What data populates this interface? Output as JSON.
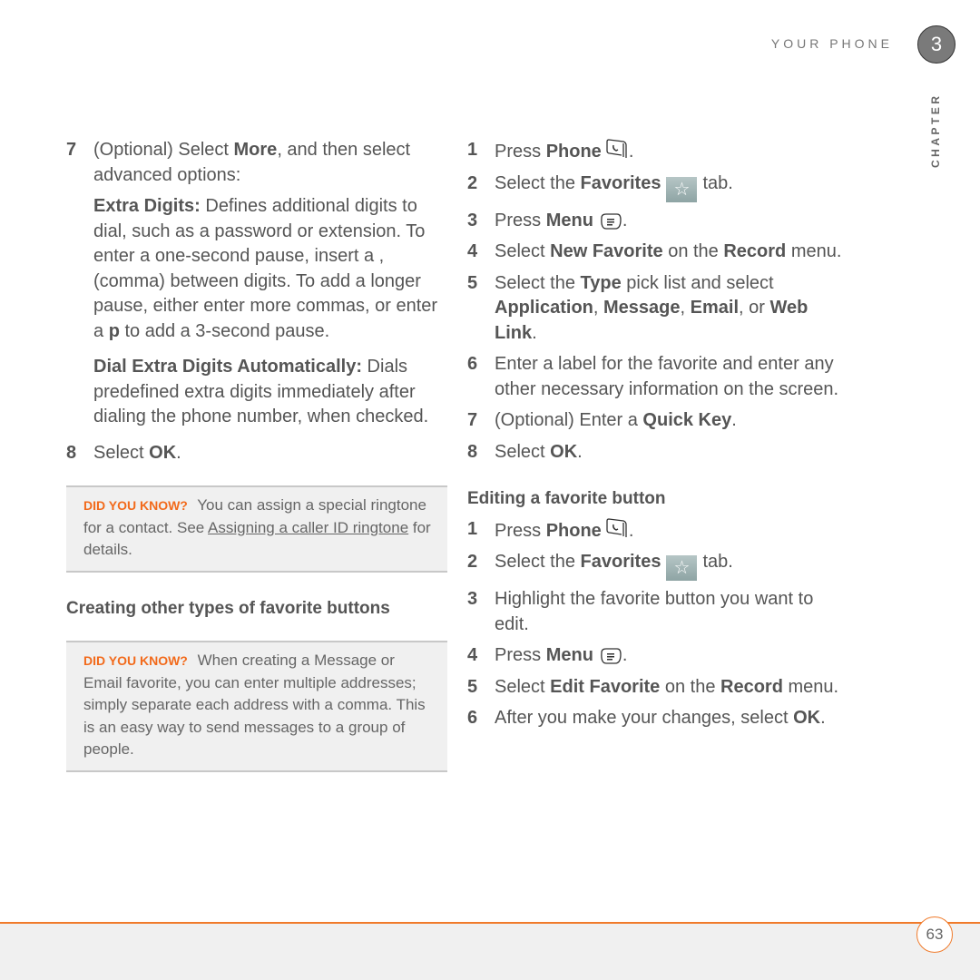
{
  "header": {
    "section_title": "YOUR PHONE",
    "chapter_number": "3",
    "chapter_label": "CHAPTER"
  },
  "left": {
    "step7": {
      "num": "7",
      "pre": "(Optional)  Select ",
      "bold": "More",
      "post": ", and then select advanced options:"
    },
    "extra_digits": {
      "term": "Extra Digits:",
      "text1": " Defines additional digits to dial, such as a password or extension. To enter a one-second pause, insert a , (comma) between digits. To add a longer pause, either enter more commas, or enter a ",
      "bold_p": "p",
      "text2": " to add a 3-second pause."
    },
    "dial_extra": {
      "term": "Dial Extra Digits Automatically:",
      "text": " Dials predefined extra digits immediately after dialing the phone number, when checked."
    },
    "step8": {
      "num": "8",
      "pre": "Select ",
      "bold": "OK",
      "post": "."
    },
    "tip1": {
      "tag": "DID YOU KNOW?",
      "text1": " You can assign a special ringtone for a contact. See ",
      "link": "Assigning a caller ID ringtone",
      "text2": " for details."
    },
    "heading": "Creating other types of favorite buttons",
    "tip2": {
      "tag": "DID YOU KNOW?",
      "text": " When creating a Message or Email favorite, you can enter multiple addresses; simply separate each address with a comma. This is an easy way to send messages to a group of people."
    }
  },
  "right": {
    "steps_a": [
      {
        "num": "1",
        "pre": "Press ",
        "bold": "Phone",
        "icon": "phone-icon",
        "post": "."
      },
      {
        "num": "2",
        "pre": "Select the ",
        "bold": "Favorites",
        "icon": "favorites-star-icon",
        "post": "tab."
      },
      {
        "num": "3",
        "pre": "Press ",
        "bold": "Menu",
        "icon": "menu-key-icon",
        "post": "."
      },
      {
        "num": "4",
        "pre": "Select ",
        "bold": "New Favorite",
        "mid": " on the ",
        "bold2": "Record",
        "post": " menu."
      },
      {
        "num": "5",
        "pre": "Select the ",
        "bold": "Type",
        "mid": " pick list and select ",
        "bold2": "Application",
        "sep1": ", ",
        "bold3": "Message",
        "sep2": ", ",
        "bold4": "Email",
        "sep3": ", or ",
        "bold5": "Web Link",
        "post": "."
      },
      {
        "num": "6",
        "text": "Enter a label for the favorite and enter any other necessary information on the  screen."
      },
      {
        "num": "7",
        "pre": "(Optional)  Enter a ",
        "bold": "Quick Key",
        "post": "."
      },
      {
        "num": "8",
        "pre": "Select ",
        "bold": "OK",
        "post": "."
      }
    ],
    "heading": "Editing a favorite button",
    "steps_b": [
      {
        "num": "1",
        "pre": "Press ",
        "bold": "Phone",
        "post": "."
      },
      {
        "num": "2",
        "pre": "Select the ",
        "bold": "Favorites",
        "post": "tab."
      },
      {
        "num": "3",
        "text": "Highlight the favorite button you want to edit."
      },
      {
        "num": "4",
        "pre": "Press ",
        "bold": "Menu",
        "post": "."
      },
      {
        "num": "5",
        "pre": "Select ",
        "bold": "Edit Favorite",
        "mid": " on the ",
        "bold2": "Record",
        "post": " menu."
      },
      {
        "num": "6",
        "pre": "After you make your changes, select ",
        "bold": "OK",
        "post": "."
      }
    ]
  },
  "footer": {
    "page_number": "63",
    "accent_color": "#f07a2a"
  }
}
